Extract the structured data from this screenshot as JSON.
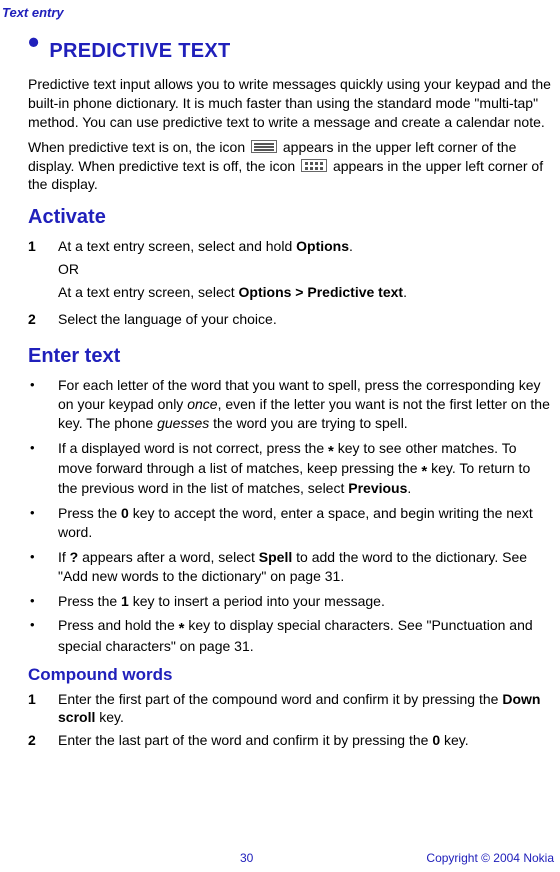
{
  "header": {
    "topic": "Text entry"
  },
  "section": {
    "title": "PREDICTIVE TEXT",
    "paragraphs": {
      "p1_a": "Predictive text input allows you to write messages quickly using your keypad and the built-in phone dictionary. It is much faster than using the standard mode \"multi-tap\" method. You can use predictive text to write a message and create a calendar note.",
      "p2_a": "When predictive text is on, the icon ",
      "p2_b": " appears in the upper left corner of the display. When predictive text is off, the icon ",
      "p2_c": " appears in the upper left corner of the display."
    }
  },
  "activate": {
    "title": "Activate",
    "step1a": "At a text entry screen, select and hold ",
    "step1a_bold": "Options",
    "step1a_end": ".",
    "or": "OR",
    "step1b": "At a text entry screen, select ",
    "step1b_bold": "Options > Predictive text",
    "step1b_end": ".",
    "step2": "Select the language of your choice."
  },
  "enter_text": {
    "title": "Enter text",
    "b1_a": "For each letter of the word that you want to spell, press the corresponding key on your keypad only ",
    "b1_i": "once",
    "b1_b": ", even if the letter you want is not the first letter on the key. The phone ",
    "b1_i2": "guesses",
    "b1_c": " the word you are trying to spell.",
    "b2_a": "If a displayed word is not correct, press the ",
    "b2_b": " key to see other matches. To move forward through a list of matches, keep pressing the ",
    "b2_c": " key. To return to the previous word in the list of matches, select ",
    "b2_bold": "Previous",
    "b2_d": ".",
    "b3_a": "Press the ",
    "b3_key": "0",
    "b3_b": " key to accept the word, enter a space, and begin writing the next word.",
    "b4_a": "If ",
    "b4_q": "?",
    "b4_b": " appears after a word, select ",
    "b4_bold": "Spell",
    "b4_c": " to add the word to the dictionary. See \"Add new words to the dictionary\" on page 31.",
    "b5_a": "Press the ",
    "b5_key": "1",
    "b5_b": " key to insert a period into your message.",
    "b6_a": "Press and hold the ",
    "b6_b": " key to display special characters. See \"Punctuation and special characters\" on page 31."
  },
  "compound": {
    "title": "Compound words",
    "s1_a": "Enter the first part of the compound word and confirm it by pressing the ",
    "s1_bold": "Down scroll",
    "s1_b": " key.",
    "s2_a": "Enter the last part of the word and confirm it by pressing the ",
    "s2_key": "0",
    "s2_b": " key."
  },
  "nums": {
    "n1": "1",
    "n2": "2"
  },
  "star": "*",
  "bullet": "•",
  "footer": {
    "page": "30",
    "copyright": "Copyright © 2004 Nokia"
  }
}
